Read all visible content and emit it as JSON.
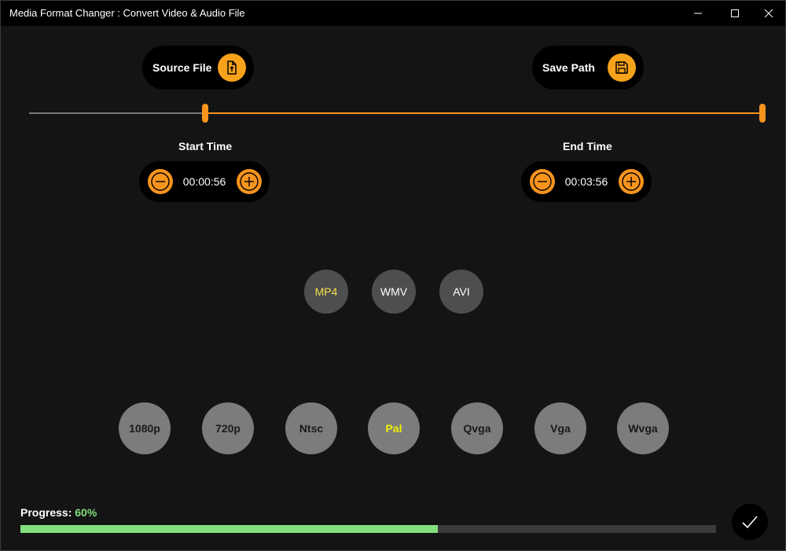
{
  "window": {
    "title": "Media Format Changer : Convert Video & Audio File"
  },
  "source": {
    "label": "Source File",
    "icon": "file-upload-icon"
  },
  "save": {
    "label": "Save Path",
    "icon": "save-disk-icon"
  },
  "trim": {
    "start_fraction": 0.24,
    "end_fraction": 1.0
  },
  "start_time": {
    "label": "Start Time",
    "value": "00:00:56"
  },
  "end_time": {
    "label": "End Time",
    "value": "00:03:56"
  },
  "formats": {
    "items": [
      "MP4",
      "WMV",
      "AVI"
    ],
    "selected": "MP4"
  },
  "resolutions": {
    "items": [
      "1080p",
      "720p",
      "Ntsc",
      "Pal",
      "Qvga",
      "Vga",
      "Wvga"
    ],
    "selected": "Pal"
  },
  "progress": {
    "label": "Progress:",
    "value_text": "60%",
    "fraction": 0.6
  },
  "colors": {
    "accent": "#f7941d",
    "progress": "#82e07e",
    "selected_text": "#f0f000"
  }
}
